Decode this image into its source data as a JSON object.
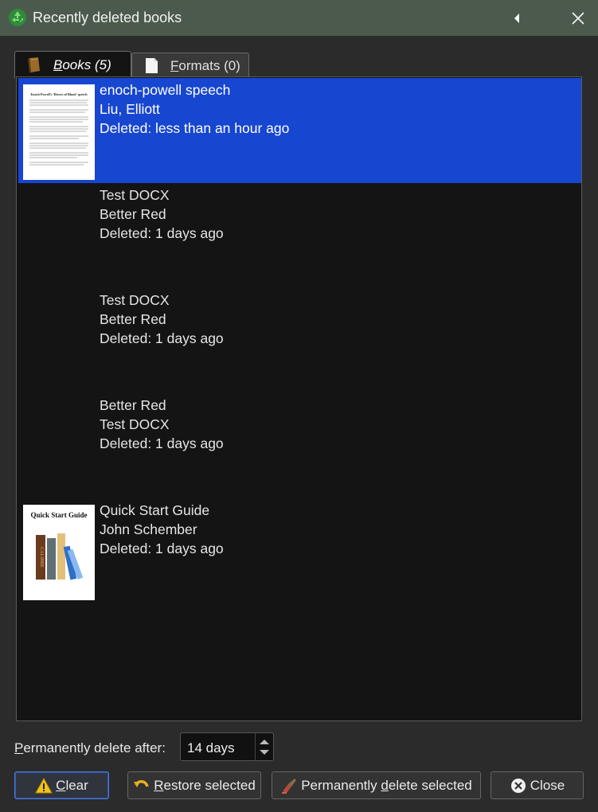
{
  "window": {
    "title": "Recently deleted books",
    "icons": {
      "app": "recycle-icon",
      "collapse": "triangle-left-icon",
      "close": "close-icon"
    }
  },
  "tabs": [
    {
      "label_accel": "B",
      "label_rest": "ooks (5)",
      "icon": "book-icon",
      "active": true
    },
    {
      "label_accel": "F",
      "label_rest": "ormats (0)",
      "icon": "page-icon",
      "active": false
    }
  ],
  "books": [
    {
      "title": "enoch-powell speech",
      "author": "Liu, Elliott",
      "deleted": "Deleted: less than an hour ago",
      "cover": "text-page",
      "selected": true
    },
    {
      "title": "Test DOCX",
      "author": "Better Red",
      "deleted": "Deleted: 1 days ago",
      "cover": "none",
      "selected": false
    },
    {
      "title": "Test DOCX",
      "author": "Better Red",
      "deleted": "Deleted: 1 days ago",
      "cover": "none",
      "selected": false
    },
    {
      "title": "Better Red",
      "author": "Test DOCX",
      "deleted": "Deleted: 1 days ago",
      "cover": "none",
      "selected": false
    },
    {
      "title": "Quick Start Guide",
      "author": "John Schember",
      "deleted": "Deleted: 1 days ago",
      "cover": "quick-start",
      "selected": false
    }
  ],
  "covers": {
    "text_page_heading": "Enoch Powell's 'Rivers of Blood' speech",
    "quick_start_heading": "Quick Start Guide",
    "quick_start_spine": "CALIBRE"
  },
  "footer": {
    "delete_after_accel": "P",
    "delete_after_rest": "ermanently delete after:",
    "delete_after_value": "14 days",
    "buttons": {
      "clear": {
        "accel": "C",
        "rest": "lear",
        "icon": "warning-icon"
      },
      "restore": {
        "accel": "R",
        "rest": "estore selected",
        "icon": "undo-icon"
      },
      "permanent": {
        "pre": "Permanently ",
        "accel": "d",
        "rest": "elete selected",
        "icon": "trash-brush-icon"
      },
      "close": {
        "label": "Close",
        "icon": "close-circle-icon"
      }
    }
  },
  "colors": {
    "selection": "#1746d0",
    "titlebar": "#4b5a4c",
    "list_bg": "#141414"
  }
}
